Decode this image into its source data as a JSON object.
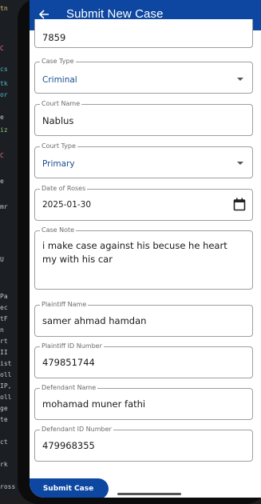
{
  "app_bar": {
    "title": "Submit New Case"
  },
  "form": {
    "case_number_value": "7859",
    "case_type": {
      "label": "Case Type",
      "value": "Criminal"
    },
    "court_name": {
      "label": "Court Name",
      "value": "Nablus"
    },
    "court_type": {
      "label": "Court Type",
      "value": "Primary"
    },
    "date_of_roses": {
      "label": "Date of Roses",
      "value": "2025-01-30"
    },
    "case_note": {
      "label": "Case Note",
      "value": "i make case against his becuse he heart my with his car"
    },
    "plaintiff_name": {
      "label": "Plaintiff Name",
      "value": "samer ahmad hamdan"
    },
    "plaintiff_id": {
      "label": "Plaintiff ID Number",
      "value": "479851744"
    },
    "defendant_name": {
      "label": "Defendant Name",
      "value": "mohamad muner fathi"
    },
    "defendant_id": {
      "label": "Defendant ID Number",
      "value": "479968355"
    }
  },
  "submit_label": "Submit Case",
  "background_ide_fragments": [
    "tn",
    "C",
    "cs",
    "tk",
    "or",
    "e",
    "iz",
    "C",
    "e",
    "mr",
    "U",
    "Pa",
    "ec",
    "tF",
    "n",
    "rt",
    "II",
    "ist",
    "oll",
    "IP,",
    "oll",
    "ge",
    "te",
    "ct",
    "rk",
    "ross"
  ],
  "colors": {
    "app_bar": "#0d47a1",
    "primary_button": "#0d47a1",
    "dropdown_value": "#1a4d8f",
    "outline": "#9e9e9e"
  },
  "icons": [
    "back-arrow-icon",
    "dropdown-arrow-icon",
    "calendar-icon"
  ]
}
